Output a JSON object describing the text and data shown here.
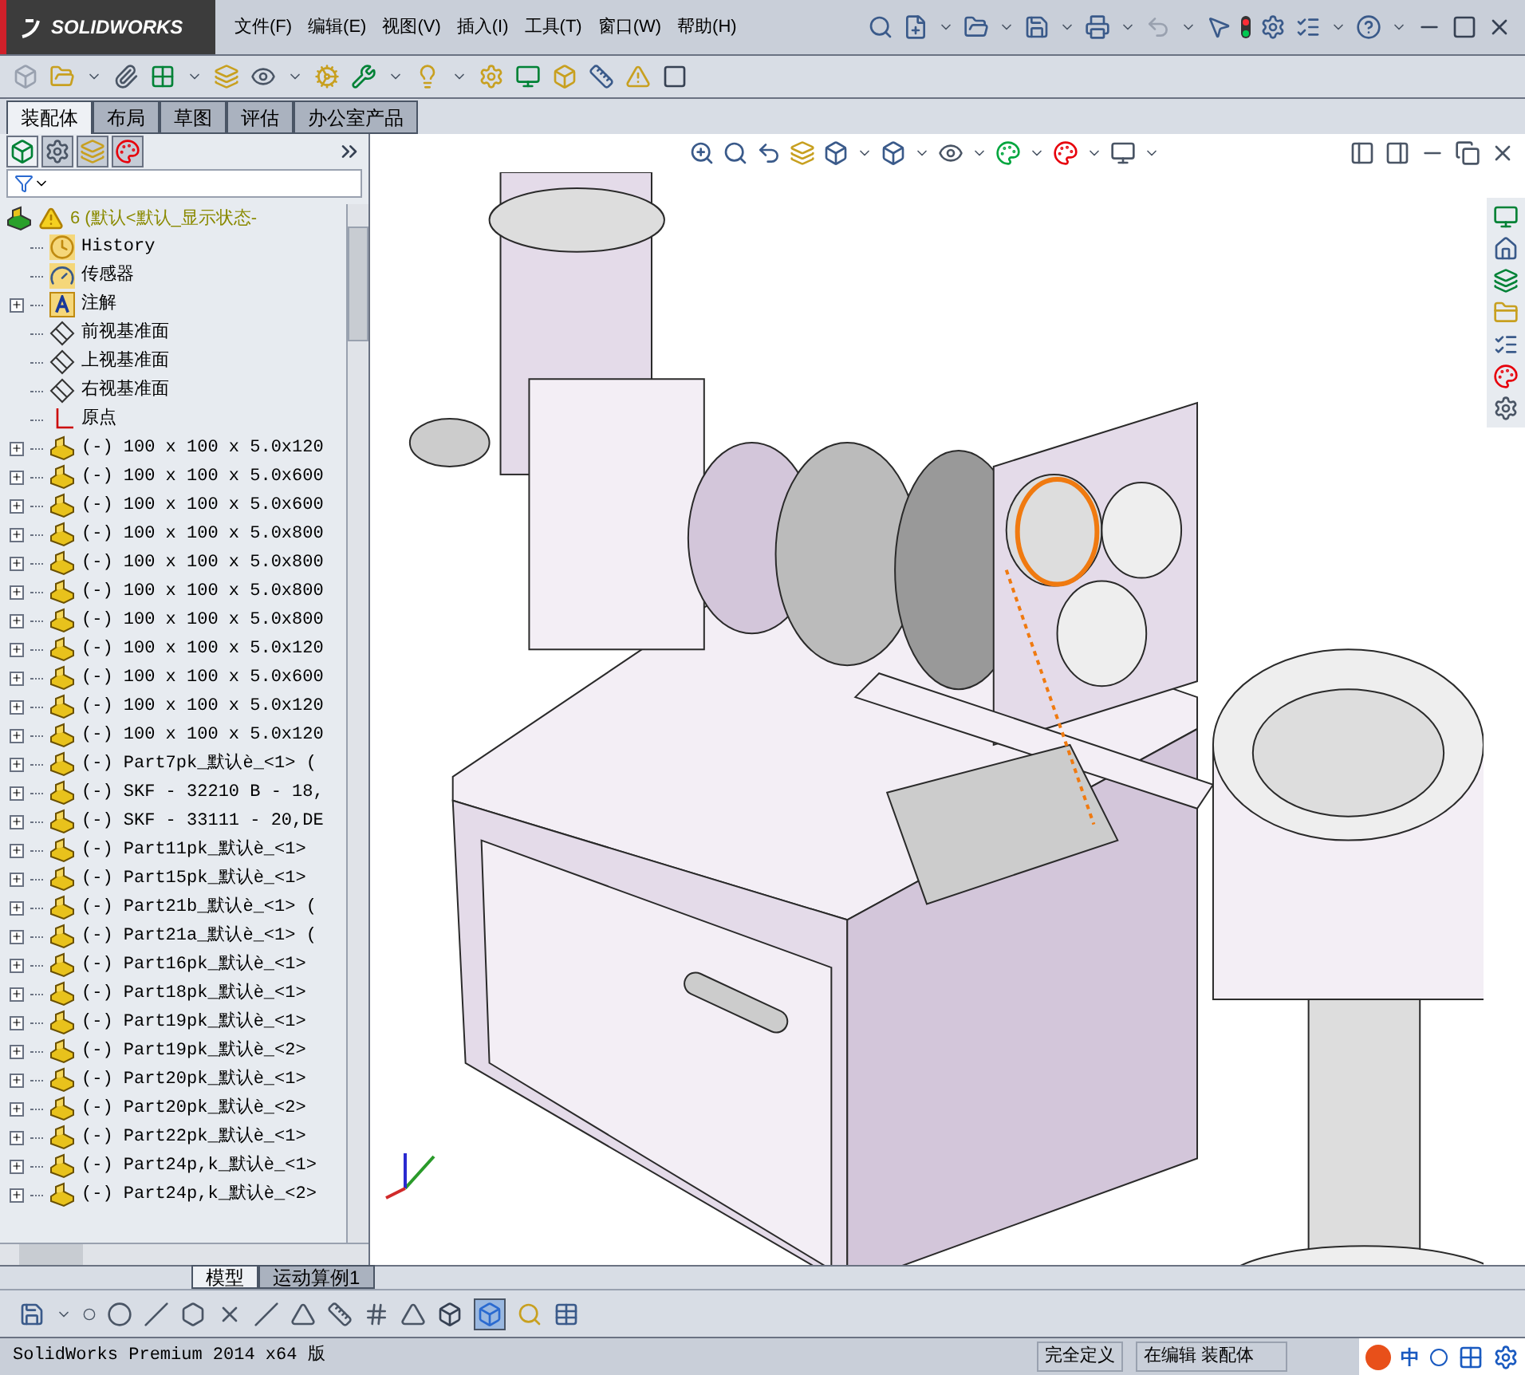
{
  "app": {
    "logo": "SOLIDWORKS"
  },
  "menu": [
    "文件(F)",
    "编辑(E)",
    "视图(V)",
    "插入(I)",
    "工具(T)",
    "窗口(W)",
    "帮助(H)"
  ],
  "command_tabs": [
    {
      "label": "装配体",
      "selected": true
    },
    {
      "label": "布局",
      "selected": false
    },
    {
      "label": "草图",
      "selected": false
    },
    {
      "label": "评估",
      "selected": false
    },
    {
      "label": "办公室产品",
      "selected": false
    }
  ],
  "feature_tree": {
    "root": {
      "label": "6 (默认<默认_显示状态-",
      "children": [
        {
          "kind": "history",
          "label": "History"
        },
        {
          "kind": "sensor",
          "label": "传感器"
        },
        {
          "kind": "annotation",
          "label": "注解",
          "expanded": false
        },
        {
          "kind": "plane",
          "label": "前视基准面"
        },
        {
          "kind": "plane",
          "label": "上视基准面"
        },
        {
          "kind": "plane",
          "label": "右视基准面"
        },
        {
          "kind": "origin",
          "label": "原点"
        },
        {
          "kind": "part",
          "label": "(-) 100 x 100 x 5.0x120",
          "expanded": false
        },
        {
          "kind": "part",
          "label": "(-) 100 x 100 x 5.0x600",
          "expanded": false
        },
        {
          "kind": "part",
          "label": "(-) 100 x 100 x 5.0x600",
          "expanded": false
        },
        {
          "kind": "part",
          "label": "(-) 100 x 100 x 5.0x800",
          "expanded": false
        },
        {
          "kind": "part",
          "label": "(-) 100 x 100 x 5.0x800",
          "expanded": false
        },
        {
          "kind": "part",
          "label": "(-) 100 x 100 x 5.0x800",
          "expanded": false
        },
        {
          "kind": "part",
          "label": "(-) 100 x 100 x 5.0x800",
          "expanded": false
        },
        {
          "kind": "part",
          "label": "(-) 100 x 100 x 5.0x120",
          "expanded": false
        },
        {
          "kind": "part",
          "label": "(-) 100 x 100 x 5.0x600",
          "expanded": false
        },
        {
          "kind": "part",
          "label": "(-) 100 x 100 x 5.0x120",
          "expanded": false
        },
        {
          "kind": "part",
          "label": "(-) 100 x 100 x 5.0x120",
          "expanded": false
        },
        {
          "kind": "part",
          "label": "(-) Part7pk_默认è_<1> (",
          "expanded": false
        },
        {
          "kind": "part",
          "label": "(-) SKF - 32210 B - 18,",
          "expanded": false
        },
        {
          "kind": "part",
          "label": "(-) SKF - 33111 - 20,DE",
          "expanded": false
        },
        {
          "kind": "part",
          "label": "(-) Part11pk_默认è_<1>",
          "expanded": false
        },
        {
          "kind": "part",
          "label": "(-) Part15pk_默认è_<1>",
          "expanded": false
        },
        {
          "kind": "part",
          "label": "(-) Part21b_默认è_<1> (",
          "expanded": false
        },
        {
          "kind": "part",
          "label": "(-) Part21a_默认è_<1> (",
          "expanded": false
        },
        {
          "kind": "part",
          "label": "(-) Part16pk_默认è_<1>",
          "expanded": false
        },
        {
          "kind": "part",
          "label": "(-) Part18pk_默认è_<1>",
          "expanded": false
        },
        {
          "kind": "part",
          "label": "(-) Part19pk_默认è_<1>",
          "expanded": false
        },
        {
          "kind": "part",
          "label": "(-) Part19pk_默认è_<2>",
          "expanded": false
        },
        {
          "kind": "part",
          "label": "(-) Part20pk_默认è_<1>",
          "expanded": false
        },
        {
          "kind": "part",
          "label": "(-) Part20pk_默认è_<2>",
          "expanded": false
        },
        {
          "kind": "part",
          "label": "(-) Part22pk_默认è_<1>",
          "expanded": false
        },
        {
          "kind": "part",
          "label": "(-) Part24p,k_默认è_<1>",
          "expanded": false
        },
        {
          "kind": "part",
          "label": "(-) Part24p,k_默认è_<2>",
          "expanded": false
        }
      ]
    }
  },
  "bottom_tabs": [
    {
      "label": "模型",
      "selected": true
    },
    {
      "label": "运动算例1",
      "selected": false
    }
  ],
  "status_bar": {
    "product": "SolidWorks Premium 2014 x64 版",
    "state": "完全定义",
    "mode": "在编辑 装配体",
    "ime": "中"
  }
}
